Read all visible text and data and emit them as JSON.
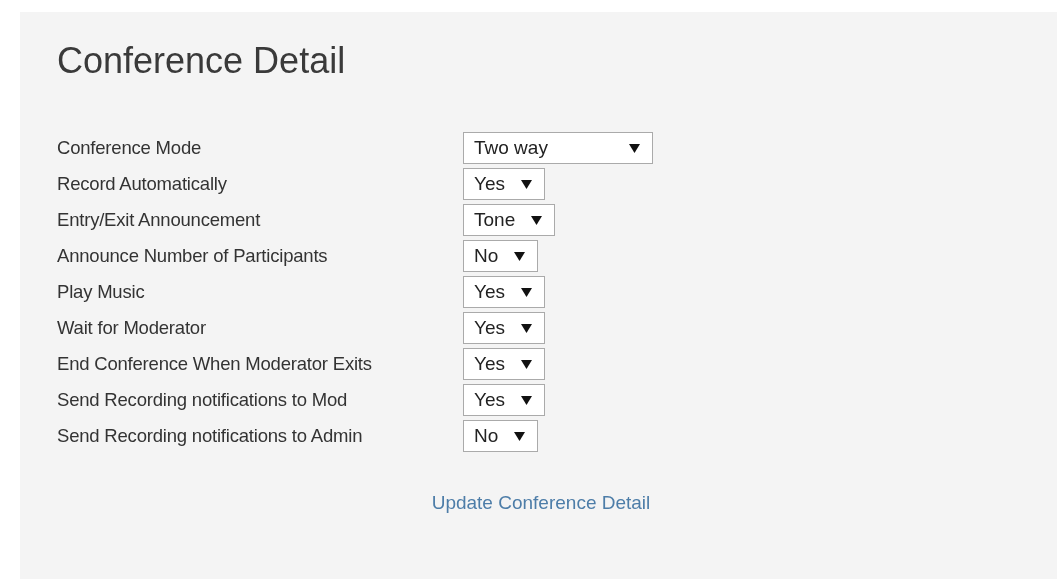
{
  "title": "Conference Detail",
  "fields": [
    {
      "label": "Conference Mode",
      "value": "Two way"
    },
    {
      "label": "Record Automatically",
      "value": "Yes"
    },
    {
      "label": "Entry/Exit Announcement",
      "value": "Tone"
    },
    {
      "label": "Announce Number of Participants",
      "value": "No"
    },
    {
      "label": "Play Music",
      "value": "Yes"
    },
    {
      "label": "Wait for Moderator",
      "value": "Yes"
    },
    {
      "label": "End Conference When Moderator Exits",
      "value": "Yes"
    },
    {
      "label": "Send Recording notifications to Mod",
      "value": "Yes"
    },
    {
      "label": "Send Recording notifications to Admin",
      "value": "No"
    }
  ],
  "submit": "Update Conference Detail"
}
